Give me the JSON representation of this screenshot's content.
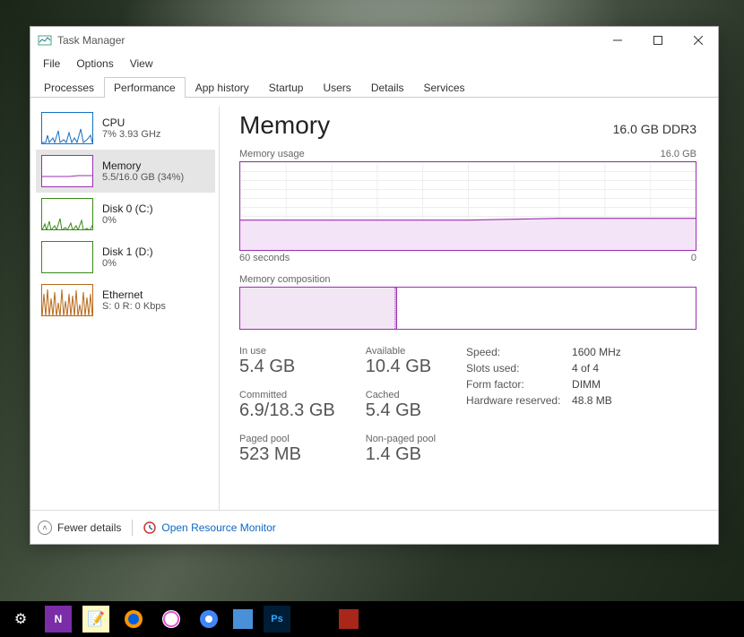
{
  "window": {
    "title": "Task Manager",
    "menu": [
      "File",
      "Options",
      "View"
    ],
    "tabs": [
      "Processes",
      "Performance",
      "App history",
      "Startup",
      "Users",
      "Details",
      "Services"
    ],
    "active_tab": 1
  },
  "sidebar": {
    "items": [
      {
        "title": "CPU",
        "sub": "7%  3.93 GHz",
        "type": "cpu"
      },
      {
        "title": "Memory",
        "sub": "5.5/16.0 GB (34%)",
        "type": "mem",
        "selected": true
      },
      {
        "title": "Disk 0 (C:)",
        "sub": "0%",
        "type": "disk"
      },
      {
        "title": "Disk 1 (D:)",
        "sub": "0%",
        "type": "disk"
      },
      {
        "title": "Ethernet",
        "sub": "S: 0  R: 0 Kbps",
        "type": "eth"
      }
    ]
  },
  "main": {
    "title": "Memory",
    "spec": "16.0 GB DDR3",
    "usage_chart": {
      "label": "Memory usage",
      "max": "16.0 GB",
      "axis_left": "60 seconds",
      "axis_right": "0"
    },
    "comp_label": "Memory composition",
    "stats": {
      "in_use": {
        "label": "In use",
        "value": "5.4 GB"
      },
      "available": {
        "label": "Available",
        "value": "10.4 GB"
      },
      "committed": {
        "label": "Committed",
        "value": "6.9/18.3 GB"
      },
      "cached": {
        "label": "Cached",
        "value": "5.4 GB"
      },
      "paged": {
        "label": "Paged pool",
        "value": "523 MB"
      },
      "nonpaged": {
        "label": "Non-paged pool",
        "value": "1.4 GB"
      }
    },
    "kv": [
      {
        "k": "Speed:",
        "v": "1600 MHz"
      },
      {
        "k": "Slots used:",
        "v": "4 of 4"
      },
      {
        "k": "Form factor:",
        "v": "DIMM"
      },
      {
        "k": "Hardware reserved:",
        "v": "48.8 MB"
      }
    ]
  },
  "footer": {
    "fewer": "Fewer details",
    "resmon": "Open Resource Monitor"
  },
  "chart_data": {
    "type": "line",
    "title": "Memory usage",
    "xlabel": "seconds",
    "ylabel": "GB",
    "x_range": [
      60,
      0
    ],
    "ylim": [
      0,
      16
    ],
    "series": [
      {
        "name": "Memory",
        "values": [
          5.4,
          5.4,
          5.4,
          5.4,
          5.4,
          5.4,
          5.4,
          5.5,
          5.5,
          5.5,
          5.5,
          5.5
        ]
      }
    ],
    "composition": {
      "in_use_pct": 34,
      "modified_pct": 0.5,
      "free_pct": 65.5
    }
  }
}
